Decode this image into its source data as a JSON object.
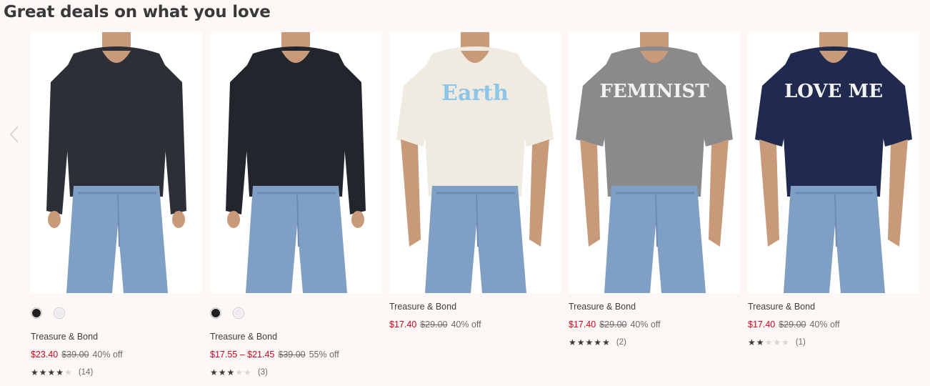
{
  "section": {
    "title": "Great deals on what you love"
  },
  "colors": {
    "sale": "#d6001c",
    "background": "#fdf8f6"
  },
  "products": [
    {
      "brand": "Treasure & Bond",
      "price": "$23.40",
      "original_price": "$39.00",
      "discount": "40% off",
      "rating": 4,
      "reviews": "(14)",
      "swatches": [
        "#202022",
        "#ecebf4"
      ],
      "image": {
        "shirt_color": "#2d2f36",
        "graphic": ""
      }
    },
    {
      "brand": "Treasure & Bond",
      "price": "$17.55 – $21.45",
      "original_price": "$39.00",
      "discount": "55% off",
      "rating": 3,
      "reviews": "(3)",
      "swatches": [
        "#202022",
        "#f1eaf0"
      ],
      "image": {
        "shirt_color": "#23252c",
        "graphic": ""
      }
    },
    {
      "brand": "Treasure & Bond",
      "price": "$17.40",
      "original_price": "$29.00",
      "discount": "40% off",
      "rating": null,
      "reviews": "",
      "swatches": [],
      "image": {
        "shirt_color": "#f0ebe0",
        "graphic": "Earth"
      }
    },
    {
      "brand": "Treasure & Bond",
      "price": "$17.40",
      "original_price": "$29.00",
      "discount": "40% off",
      "rating": 5,
      "reviews": "(2)",
      "swatches": [],
      "image": {
        "shirt_color": "#8a8a8c",
        "graphic": "FEMINIST"
      }
    },
    {
      "brand": "Treasure & Bond",
      "price": "$17.40",
      "original_price": "$29.00",
      "discount": "40% off",
      "rating": 2,
      "reviews": "(1)",
      "swatches": [],
      "image": {
        "shirt_color": "#1f2a4e",
        "graphic": "LOVE ME"
      }
    }
  ],
  "icons": {
    "prev": "chevron-left-icon",
    "next": "chevron-right-icon"
  }
}
